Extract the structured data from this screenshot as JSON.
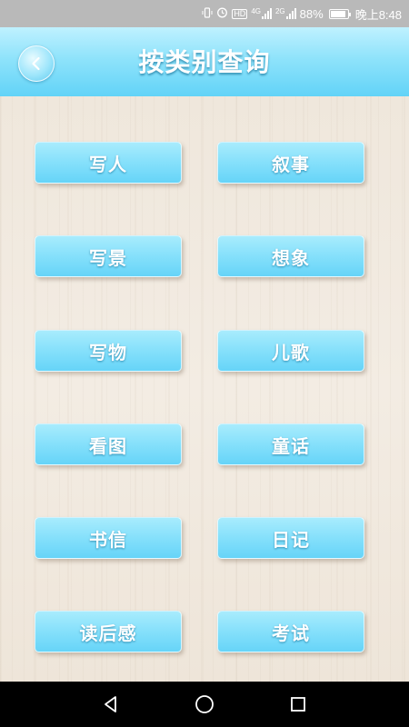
{
  "status_bar": {
    "network_4g": "4G",
    "network_2g": "2G",
    "hd_badge": "HD",
    "battery": "88%",
    "battery_level": 0.88,
    "time": "晚上8:48"
  },
  "header": {
    "title": "按类别查询",
    "back_icon": "chevron-left-icon"
  },
  "categories": [
    {
      "label": "写人"
    },
    {
      "label": "叙事"
    },
    {
      "label": "写景"
    },
    {
      "label": "想象"
    },
    {
      "label": "写物"
    },
    {
      "label": "儿歌"
    },
    {
      "label": "看图"
    },
    {
      "label": "童话"
    },
    {
      "label": "书信"
    },
    {
      "label": "日记"
    },
    {
      "label": "读后感"
    },
    {
      "label": "考试"
    }
  ],
  "nav_bar": {
    "icons": [
      "back-triangle-icon",
      "home-circle-icon",
      "recents-square-icon"
    ]
  },
  "colors": {
    "accent": "#66d4f8",
    "header_light": "#bff1ff",
    "background": "#efe7dc"
  }
}
